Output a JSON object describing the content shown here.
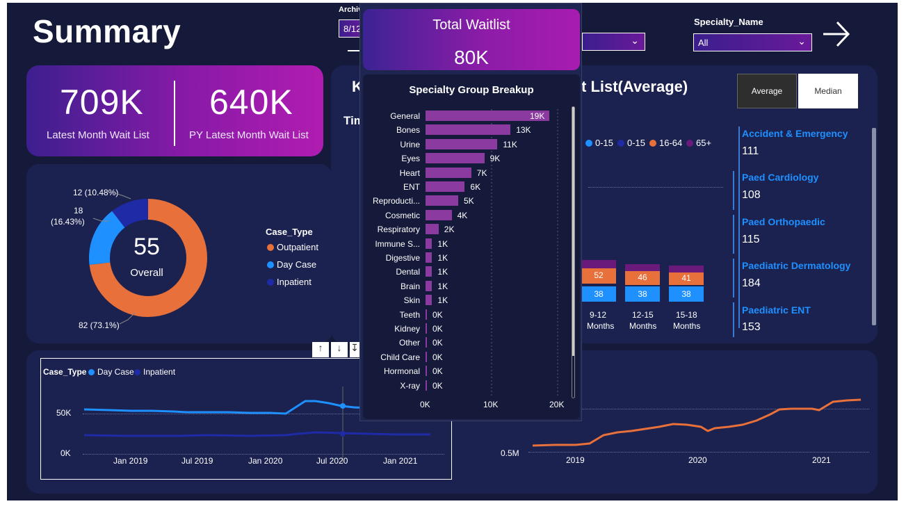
{
  "page_title": "Summary",
  "slicers": {
    "archive_label": "Archiv",
    "archive_value": "8/12",
    "specialty_label": "Specialty_Name",
    "specialty_value": "All"
  },
  "kpi": {
    "latest_value": "709K",
    "latest_label": "Latest Month Wait List",
    "py_value": "640K",
    "py_label": "PY Latest Month Wait List"
  },
  "donut": {
    "center_value": "55",
    "center_label": "Overall",
    "labels": {
      "outpatient": "82 (73.1%)",
      "day_case_line1": "18",
      "day_case_line2": "(16.43%)",
      "inpatient": "12 (10.48%)"
    },
    "legend_title": "Case_Type",
    "legend": [
      "Outpatient",
      "Day Case",
      "Inpatient"
    ],
    "colors": {
      "outpatient": "#e8703a",
      "day_case": "#1e90ff",
      "inpatient": "#1f2aa6"
    },
    "values": [
      73.1,
      16.43,
      10.48
    ]
  },
  "middle": {
    "title_partial_left": "K",
    "title_partial_right": "t List(Average)",
    "sub_partial": "Tim",
    "age_legend": [
      "0-15",
      "0-15",
      "16-64",
      "65+"
    ],
    "age_colors": [
      "#1e90ff",
      "#1f2aa6",
      "#e8703a",
      "#6a1a7a"
    ],
    "bars": [
      {
        "label1": "9-12",
        "label2": "Months",
        "top": "52",
        "bottom": "38"
      },
      {
        "label1": "12-15",
        "label2": "Months",
        "top": "46",
        "bottom": "38"
      },
      {
        "label1": "15-18",
        "label2": "Months",
        "top": "41",
        "bottom": "38"
      }
    ]
  },
  "toggle": {
    "average": "Average",
    "median": "Median"
  },
  "specialty_list": [
    {
      "name": "Accident & Emergency",
      "value": "111"
    },
    {
      "name": "Paed Cardiology",
      "value": "108"
    },
    {
      "name": "Paed Orthopaedic",
      "value": "115"
    },
    {
      "name": "Paediatric Dermatology",
      "value": "184"
    },
    {
      "name": "Paediatric ENT",
      "value": "153"
    }
  ],
  "line_chart_left": {
    "legend_title": "Case_Type",
    "legend": [
      "Day Case",
      "Inpatient"
    ],
    "y_ticks": [
      "50K",
      "0K"
    ],
    "x_ticks": [
      "Jan 2019",
      "Jul 2019",
      "Jan 2020",
      "Jul 2020",
      "Jan 2021"
    ]
  },
  "line_chart_right": {
    "y_ticks": [
      "0.5M"
    ],
    "x_ticks": [
      "2019",
      "2020",
      "2021"
    ]
  },
  "popup": {
    "title": "Total Waitlist",
    "value": "80K",
    "breakup_title": "Specialty Group Breakup",
    "x_ticks": [
      "0K",
      "10K",
      "20K"
    ],
    "chart_data": {
      "type": "bar",
      "title": "Specialty Group Breakup",
      "categories": [
        "General",
        "Bones",
        "Urine",
        "Eyes",
        "Heart",
        "ENT",
        "Reproducti...",
        "Cosmetic",
        "Respiratory",
        "Immune S...",
        "Digestive",
        "Dental",
        "Brain",
        "Skin",
        "Teeth",
        "Kidney",
        "Other",
        "Child Care",
        "Hormonal",
        "X-ray"
      ],
      "values": [
        19,
        13,
        11,
        9,
        7,
        6,
        5,
        4,
        2,
        1,
        1,
        1,
        1,
        1,
        0,
        0,
        0,
        0,
        0,
        0
      ],
      "labels": [
        "19K",
        "13K",
        "11K",
        "9K",
        "7K",
        "6K",
        "5K",
        "4K",
        "2K",
        "1K",
        "1K",
        "1K",
        "1K",
        "1K",
        "0K",
        "0K",
        "0K",
        "0K",
        "0K",
        "0K"
      ],
      "xlim": [
        0,
        20
      ],
      "color": "#8b3aa0"
    }
  }
}
